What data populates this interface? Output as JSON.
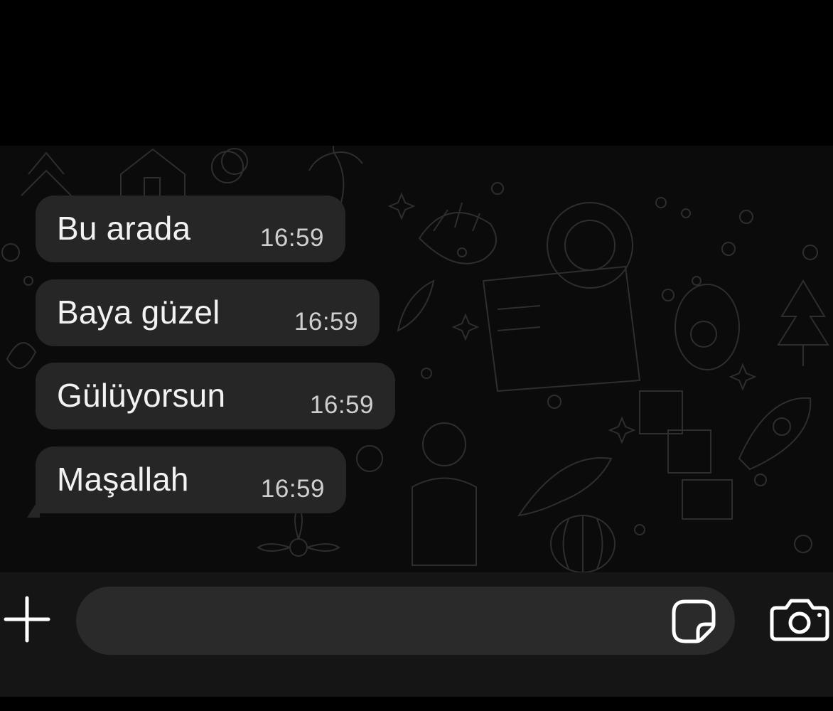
{
  "chat": {
    "messages": [
      {
        "text": "Bu arada",
        "time": "16:59"
      },
      {
        "text": "Baya güzel",
        "time": "16:59"
      },
      {
        "text": "Gülüyorsun",
        "time": "16:59"
      },
      {
        "text": "Maşallah",
        "time": "16:59"
      }
    ]
  },
  "composer": {
    "value": "",
    "placeholder": ""
  },
  "icons": {
    "plus": "plus-icon",
    "sticker": "sticker-icon",
    "camera": "camera-icon"
  },
  "colors": {
    "background": "#000000",
    "chat_background": "#0b0b0b",
    "bubble": "#262626",
    "text": "#f2f2f2",
    "timestamp": "#cfcfcf",
    "input_bar": "#151515",
    "input_field": "#2a2a2a",
    "icon": "#ffffff"
  }
}
